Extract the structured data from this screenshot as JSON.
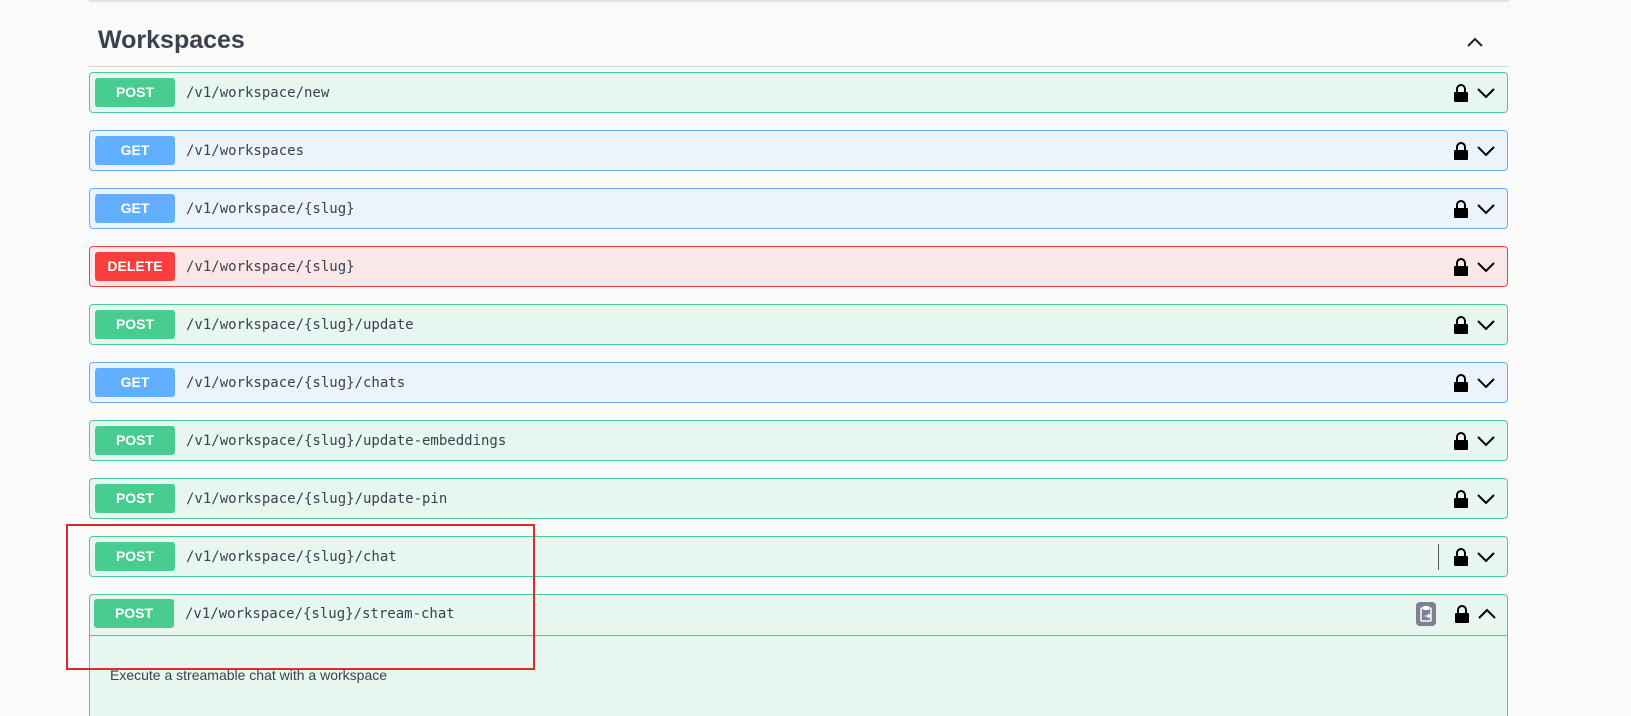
{
  "section": {
    "title": "Workspaces"
  },
  "operations": [
    {
      "method": "POST",
      "path": "/v1/workspace/new"
    },
    {
      "method": "GET",
      "path": "/v1/workspaces"
    },
    {
      "method": "GET",
      "path": "/v1/workspace/{slug}"
    },
    {
      "method": "DELETE",
      "path": "/v1/workspace/{slug}"
    },
    {
      "method": "POST",
      "path": "/v1/workspace/{slug}/update"
    },
    {
      "method": "GET",
      "path": "/v1/workspace/{slug}/chats"
    },
    {
      "method": "POST",
      "path": "/v1/workspace/{slug}/update-embeddings"
    },
    {
      "method": "POST",
      "path": "/v1/workspace/{slug}/update-pin"
    },
    {
      "method": "POST",
      "path": "/v1/workspace/{slug}/chat"
    }
  ],
  "expanded_operation": {
    "method": "POST",
    "path": "/v1/workspace/{slug}/stream-chat",
    "description": "Execute a streamable chat with a workspace"
  },
  "colors": {
    "post": "#49cc90",
    "get": "#61affe",
    "delete": "#f93e3e",
    "highlight": "#e02a2a"
  },
  "icons": {
    "lock": "lock-icon",
    "expand": "chevron-down-icon",
    "collapse": "chevron-up-icon",
    "copy": "clipboard-icon"
  }
}
